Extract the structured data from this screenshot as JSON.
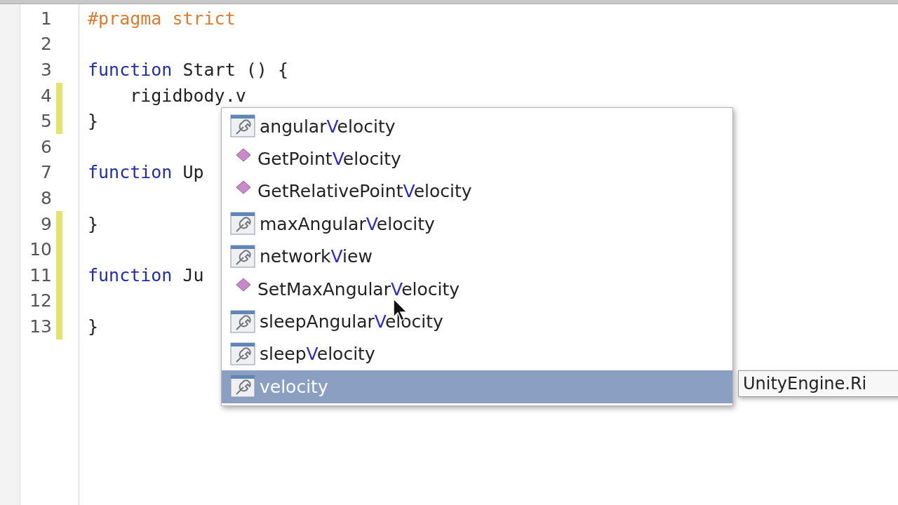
{
  "editor": {
    "lines": [
      {
        "number": "1",
        "changed": false,
        "tokens": [
          {
            "kind": "directive",
            "text": "#pragma strict"
          }
        ]
      },
      {
        "number": "2",
        "changed": false
      },
      {
        "number": "3",
        "changed": false,
        "tokens": [
          {
            "kind": "keyword",
            "text": "function"
          },
          {
            "kind": "plain",
            "text": " Start () {"
          }
        ]
      },
      {
        "number": "4",
        "changed": true,
        "tokens": [
          {
            "kind": "plain",
            "text": "    rigidbody.v"
          }
        ]
      },
      {
        "number": "5",
        "changed": true,
        "tokens": [
          {
            "kind": "plain",
            "text": "}"
          }
        ]
      },
      {
        "number": "6",
        "changed": false
      },
      {
        "number": "7",
        "changed": false,
        "tokens": [
          {
            "kind": "keyword",
            "text": "function"
          },
          {
            "kind": "plain",
            "text": " Up"
          }
        ]
      },
      {
        "number": "8",
        "changed": false
      },
      {
        "number": "9",
        "changed": true,
        "tokens": [
          {
            "kind": "plain",
            "text": "}"
          }
        ]
      },
      {
        "number": "10",
        "changed": true
      },
      {
        "number": "11",
        "changed": true,
        "tokens": [
          {
            "kind": "keyword",
            "text": "function"
          },
          {
            "kind": "plain",
            "text": " Ju"
          }
        ]
      },
      {
        "number": "12",
        "changed": true
      },
      {
        "number": "13",
        "changed": true,
        "tokens": [
          {
            "kind": "plain",
            "text": "}"
          }
        ]
      }
    ]
  },
  "completion": {
    "items": [
      {
        "kind": "property",
        "before": "angular",
        "match": "V",
        "after": "elocity",
        "selected": false
      },
      {
        "kind": "method",
        "before": "GetPoint",
        "match": "V",
        "after": "elocity",
        "selected": false
      },
      {
        "kind": "method",
        "before": "GetRelativePoint",
        "match": "V",
        "after": "elocity",
        "selected": false
      },
      {
        "kind": "property",
        "before": "maxAngular",
        "match": "V",
        "after": "elocity",
        "selected": false
      },
      {
        "kind": "property",
        "before": "network",
        "match": "V",
        "after": "iew",
        "selected": false
      },
      {
        "kind": "method",
        "before": "SetMaxAngular",
        "match": "V",
        "after": "elocity",
        "selected": false
      },
      {
        "kind": "property",
        "before": "sleepAngular",
        "match": "V",
        "after": "elocity",
        "selected": false
      },
      {
        "kind": "property",
        "before": "sleep",
        "match": "V",
        "after": "elocity",
        "selected": false
      },
      {
        "kind": "property",
        "match": "v",
        "after": "elocity",
        "selected": true
      }
    ],
    "tooltip": "UnityEngine.Ri"
  }
}
